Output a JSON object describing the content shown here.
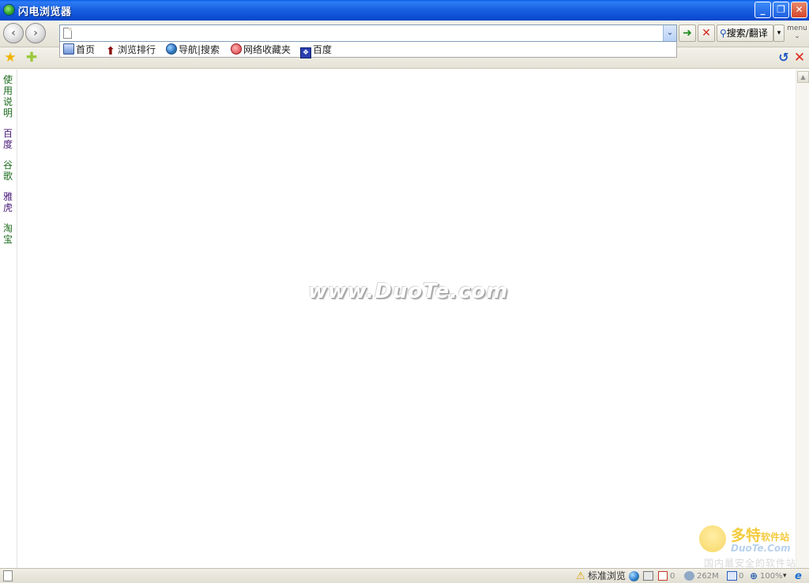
{
  "window": {
    "title": "闪电浏览器",
    "minimize_label": "_",
    "maximize_label": "❐",
    "close_label": "✕"
  },
  "toolbar": {
    "back_label": "‹",
    "forward_label": "›",
    "address_value": "",
    "address_dropdown_label": "⌄",
    "go_label": "➜",
    "stop_label": "✕",
    "search_label": "搜索/翻译",
    "search_dropdown_label": "▾",
    "menu_label": "menu",
    "menu_chevron": "⌄"
  },
  "links": [
    {
      "label": "首页",
      "icon": "home-icon"
    },
    {
      "label": "浏览排行",
      "icon": "rank-arrow-icon"
    },
    {
      "label": "导航|搜索",
      "icon": "globe-icon"
    },
    {
      "label": "网络收藏夹",
      "icon": "favorites-heart-icon"
    },
    {
      "label": "百度",
      "icon": "baidu-paw-icon"
    }
  ],
  "favbar": {
    "fav_icon": "★",
    "add_icon": "✚",
    "refresh_icon": "↺",
    "close_icon": "✕"
  },
  "sidebar": {
    "items": [
      "使用说明",
      "百度",
      "谷歌",
      "雅虎",
      "淘宝"
    ]
  },
  "content": {
    "watermark": "www.DuoTe.com",
    "logo_cn": "多特",
    "logo_cn_suffix": "软件站",
    "logo_en": "DuoTe.Com",
    "logo_tag": "国内最安全的软件站",
    "scroll_up": "▲"
  },
  "statusbar": {
    "warn_icon": "⚠",
    "mode_label": "标准浏览",
    "popup_count": "0",
    "memory_label": "262M",
    "window_count": "0",
    "zoom_icon": "⊕",
    "zoom_label": "100%",
    "zoom_dropdown": "▾",
    "ie_icon": "e"
  },
  "colors": {
    "titlebar": "#0a5ee8",
    "toolbar_bg": "#ece9d8",
    "sidebar_text": "#1b6b1b"
  }
}
